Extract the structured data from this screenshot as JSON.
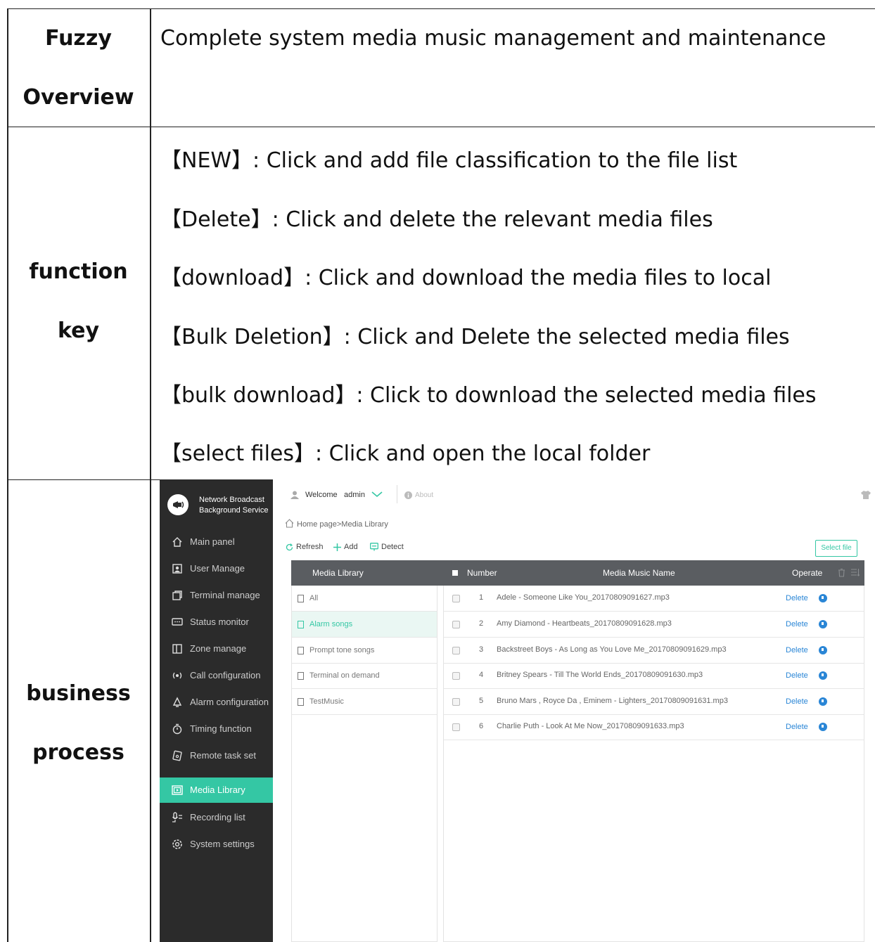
{
  "table": {
    "overview": {
      "label": [
        "Fuzzy",
        "Overview"
      ],
      "text": "Complete system media music management and maintenance"
    },
    "function_key": {
      "label": [
        "function",
        "key"
      ],
      "lines": [
        "【NEW】: Click and add file classification to the file list",
        "【Delete】: Click and delete the relevant media files",
        "【download】: Click and download the media files to local",
        "【Bulk Deletion】:  Click and Delete the selected media files",
        "【bulk download】: Click to download the selected media files",
        "【select files】:  Click and open the local folder"
      ]
    },
    "business_process": {
      "label": [
        "business",
        "process"
      ]
    }
  },
  "app": {
    "brand": [
      "Network Broadcast",
      "Background Service"
    ],
    "welcome": "Welcome",
    "user": "admin",
    "about": "About",
    "breadcrumb": "Home page>Media Library",
    "toolbar": {
      "refresh": "Refresh",
      "add": "Add",
      "detect": "Detect",
      "select_file": "Select file"
    },
    "nav": [
      "Main panel",
      "User Manage",
      "Terminal manage",
      "Status monitor",
      "Zone manage",
      "Call configuration",
      "Alarm configuration",
      "Timing function",
      "Remote task set",
      "Media Library",
      "Recording list",
      "System settings"
    ],
    "active_nav": "Media Library",
    "accent_color": "#34c7a4",
    "headers": {
      "library": "Media Library",
      "number": "Number",
      "name": "Media Music Name",
      "operate": "Operate"
    },
    "libraries": [
      "All",
      "Alarm songs",
      "Prompt tone songs",
      "Terminal on demand",
      "TestMusic"
    ],
    "selected_library": "Alarm songs",
    "music": [
      {
        "no": "1",
        "name": "Adele - Someone Like You_20170809091627.mp3"
      },
      {
        "no": "2",
        "name": "Amy Diamond - Heartbeats_20170809091628.mp3"
      },
      {
        "no": "3",
        "name": "Backstreet Boys - As Long as You Love Me_20170809091629.mp3"
      },
      {
        "no": "4",
        "name": "Britney Spears - Till The World Ends_20170809091630.mp3"
      },
      {
        "no": "5",
        "name": "Bruno Mars , Royce Da , Eminem - Lighters_20170809091631.mp3"
      },
      {
        "no": "6",
        "name": "Charlie Puth - Look At Me Now_20170809091633.mp3"
      }
    ],
    "delete_label": "Delete"
  }
}
